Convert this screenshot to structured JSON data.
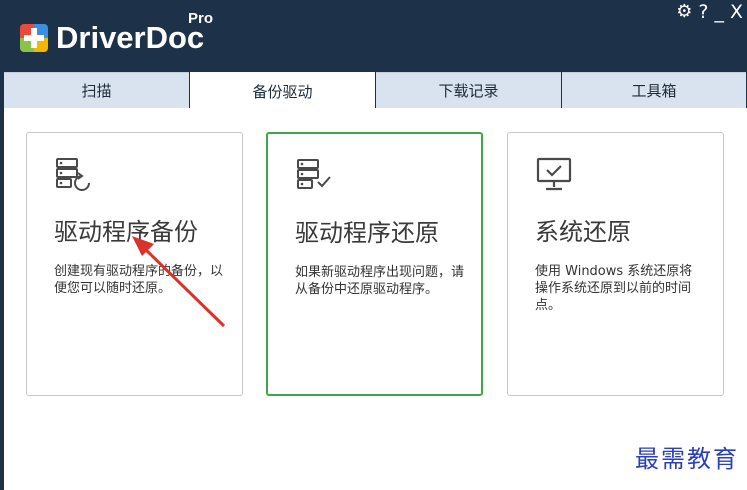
{
  "app": {
    "logo_text": "DriverDoc",
    "logo_badge": "Pro"
  },
  "window_controls": {
    "settings": "⚙",
    "help": "?",
    "minimize": "_",
    "close": "X"
  },
  "tabs": [
    {
      "label": "扫描",
      "active": false
    },
    {
      "label": "备份驱动",
      "active": true
    },
    {
      "label": "下载记录",
      "active": false
    },
    {
      "label": "工具箱",
      "active": false
    }
  ],
  "cards": [
    {
      "icon": "server-backup-icon",
      "title": "驱动程序备份",
      "desc": "创建现有驱动程序的备份，以便您可以随时还原。"
    },
    {
      "icon": "server-check-icon",
      "title": "驱动程序还原",
      "desc": "如果新驱动程序出现问题，请从备份中还原驱动程序。"
    },
    {
      "icon": "monitor-check-icon",
      "title": "系统还原",
      "desc": "使用 Windows 系统还原将操作系统还原到以前的时间点。"
    }
  ],
  "watermark": "最需教育",
  "colors": {
    "titlebar": "#1d3148",
    "selected_border": "#3fa64b",
    "arrow": "#d9332b",
    "watermark": "#2b3fb7"
  }
}
